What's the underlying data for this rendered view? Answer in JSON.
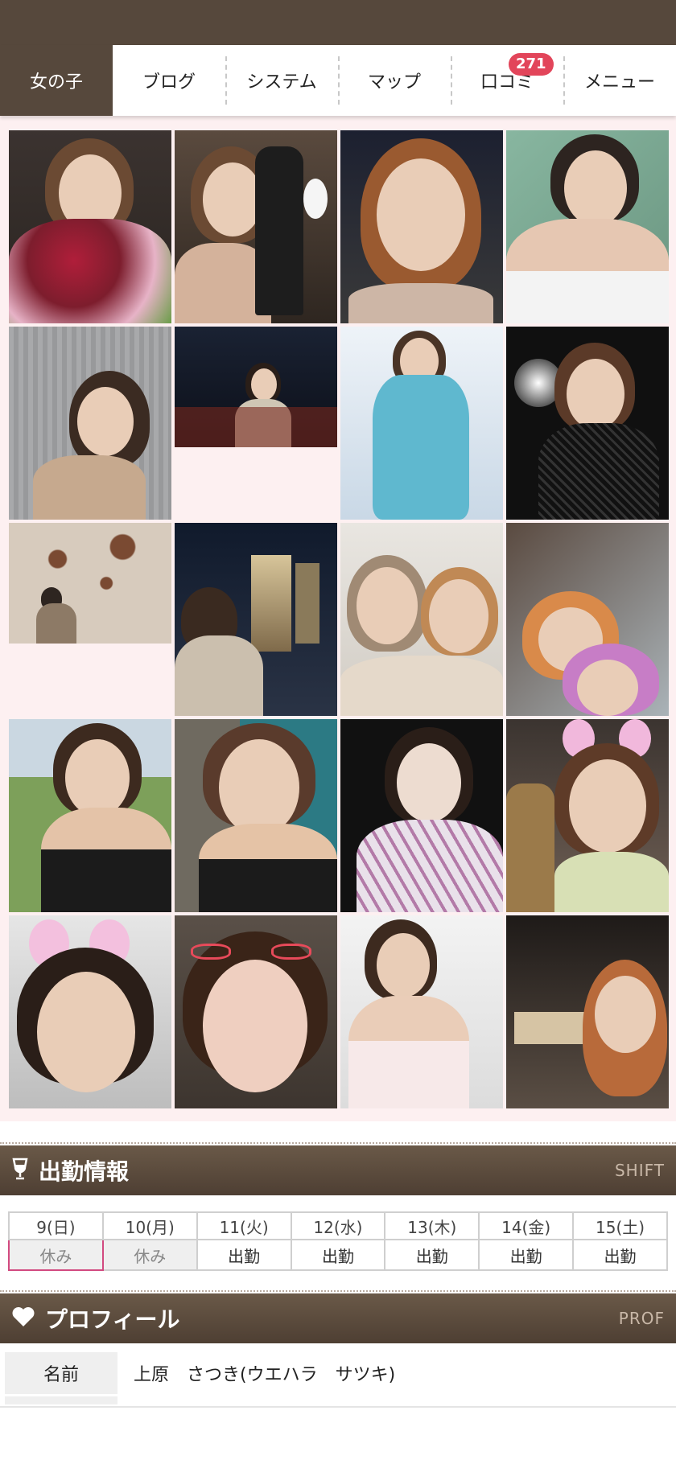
{
  "nav": {
    "tabs": [
      {
        "label": "女の子"
      },
      {
        "label": "ブログ"
      },
      {
        "label": "システム"
      },
      {
        "label": "マップ"
      },
      {
        "label": "口コミ",
        "badge": "271"
      },
      {
        "label": "メニュー"
      }
    ]
  },
  "shift": {
    "title": "出勤情報",
    "en": "SHIFT",
    "days": [
      "9(日)",
      "10(月)",
      "11(火)",
      "12(水)",
      "13(木)",
      "14(金)",
      "15(土)"
    ],
    "status": [
      "休み",
      "休み",
      "出勤",
      "出勤",
      "出勤",
      "出勤",
      "出勤"
    ]
  },
  "profile": {
    "title": "プロフィール",
    "en": "PROF",
    "name_label": "名前",
    "name_value": "上原　さつき(ウエハラ　サツキ)"
  },
  "colors": {
    "header": "#56483c",
    "badge": "#e2455a",
    "saturday": "#35b6d4",
    "gallery_bg": "#fdf0f1"
  }
}
